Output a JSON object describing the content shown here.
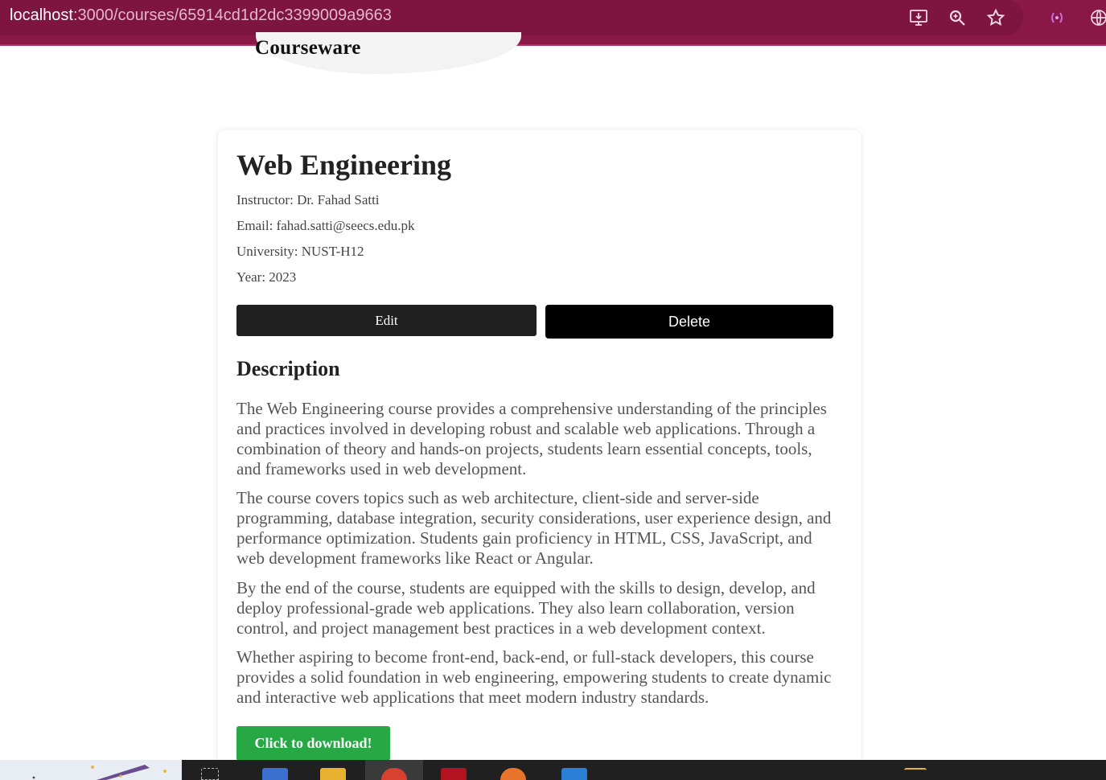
{
  "browser": {
    "url_host": "localhost",
    "url_path": ":3000/courses/65914cd1d2dc3399009a9663",
    "icons": [
      "install-app-icon",
      "zoom-icon",
      "bookmark-star-icon",
      "extension-icon",
      "globe-icon"
    ]
  },
  "header": {
    "logo_text": "Courseware"
  },
  "course": {
    "title": "Web Engineering",
    "instructor": "Instructor: Dr. Fahad Satti",
    "email": "Email: fahad.satti@seecs.edu.pk",
    "university": "University: NUST-H12",
    "year": "Year: 2023",
    "edit_label": "Edit",
    "delete_label": "Delete",
    "description_heading": "Description",
    "description": [
      "The Web Engineering course provides a comprehensive understanding of the principles and practices involved in developing robust and scalable web applications. Through a combination of theory and hands-on projects, students learn essential concepts, tools, and frameworks used in web development.",
      "The course covers topics such as web architecture, client-side and server-side programming, database integration, security considerations, user experience design, and performance optimization. Students gain proficiency in HTML, CSS, JavaScript, and web development frameworks like React or Angular.",
      "By the end of the course, students are equipped with the skills to design, develop, and deploy professional-grade web applications. They also learn collaboration, version control, and project management best practices in a web development context.",
      "Whether aspiring to become front-end, back-end, or full-stack developers, this course provides a solid foundation in web engineering, empowering students to create dynamic and interactive web applications that meet modern industry standards."
    ],
    "download_label": "Click to download!"
  },
  "colors": {
    "browser_bar": "#891847",
    "edit_button": "#202020",
    "delete_button": "#000000",
    "download_button": "#28a745",
    "taskbar": "#202020"
  }
}
